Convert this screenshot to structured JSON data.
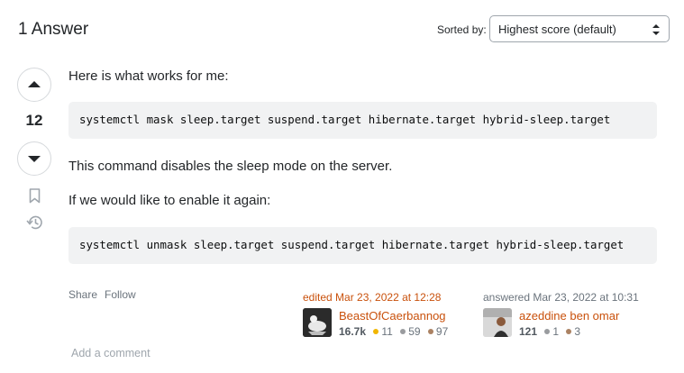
{
  "header": {
    "title": "1 Answer",
    "sort_label": "Sorted by:",
    "sort_value": "Highest score (default)"
  },
  "answer": {
    "vote_count": "12",
    "paragraphs": [
      "Here is what works for me:",
      "This command disables the sleep mode on the server.",
      "If we would like to enable it again:"
    ],
    "code_blocks": [
      "systemctl mask sleep.target suspend.target hibernate.target hybrid-sleep.target",
      "systemctl unmask sleep.target suspend.target hibernate.target hybrid-sleep.target"
    ],
    "menu": {
      "share": "Share",
      "follow": "Follow"
    },
    "editor": {
      "action": "edited Mar 23, 2022 at 12:28",
      "name": "BeastOfCaerbannog",
      "reputation": "16.7k",
      "gold": "11",
      "silver": "59",
      "bronze": "97"
    },
    "author": {
      "action": "answered Mar 23, 2022 at 10:31",
      "name": "azeddine ben omar",
      "reputation": "121",
      "silver": "1",
      "bronze": "3"
    },
    "add_comment": "Add a comment"
  },
  "icons": {
    "upvote": "arrow-up-icon",
    "downvote": "arrow-down-icon",
    "bookmark": "bookmark-icon",
    "history": "history-icon",
    "select": "chevron-updown-icon"
  },
  "colors": {
    "link_orange": "#c9510c",
    "edit_red": "#d1383d",
    "muted": "#6a737c",
    "code_bg": "#f1f2f3"
  }
}
